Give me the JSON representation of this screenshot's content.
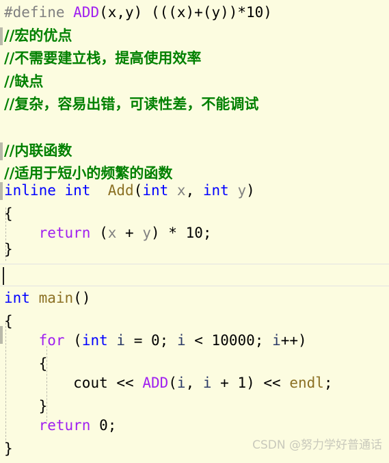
{
  "editor": {
    "background_color": "#fcfce0",
    "current_line_index": 11,
    "language": "C++",
    "watermark": "CSDN @努力学好普通话",
    "lines": [
      {
        "n": 0,
        "text": "#define ADD(x,y) (((x)+(y))*10)"
      },
      {
        "n": 1,
        "text": "//宏的优点"
      },
      {
        "n": 2,
        "text": "//不需要建立栈，提高使用效率"
      },
      {
        "n": 3,
        "text": "//缺点"
      },
      {
        "n": 4,
        "text": "//复杂，容易出错，可读性差，不能调试"
      },
      {
        "n": 5,
        "text": ""
      },
      {
        "n": 6,
        "text": "//内联函数"
      },
      {
        "n": 7,
        "text": "//适用于短小的频繁的函数"
      },
      {
        "n": 8,
        "text": "inline int  Add(int x, int y)"
      },
      {
        "n": 9,
        "text": "{"
      },
      {
        "n": 10,
        "text": "    return (x + y) * 10;"
      },
      {
        "n": 11,
        "text": "}"
      },
      {
        "n": 12,
        "text": ""
      },
      {
        "n": 13,
        "text": "int main()"
      },
      {
        "n": 14,
        "text": "{"
      },
      {
        "n": 15,
        "text": "    for (int i = 0; i < 10000; i++)"
      },
      {
        "n": 16,
        "text": "    {"
      },
      {
        "n": 17,
        "text": "        cout << ADD(i, i + 1) << endl;"
      },
      {
        "n": 18,
        "text": "    }"
      },
      {
        "n": 19,
        "text": "    return 0;"
      },
      {
        "n": 20,
        "text": "}"
      }
    ],
    "tokens": {
      "l0_a": "#define ",
      "l0_b": "ADD",
      "l0_c": "(x,y) (((x)+(y))*10)",
      "l1": "//宏的优点",
      "l2": "//不需要建立栈，提高使用效率",
      "l3": "//缺点",
      "l4": "//复杂，容易出错，可读性差，不能调试",
      "l6": "//内联函数",
      "l7": "//适用于短小的频繁的函数",
      "l8_a": "inline int",
      "l8_b": "  ",
      "l8_c": "Add",
      "l8_d": "(",
      "l8_e": "int",
      "l8_f": " x",
      "l8_g": ", ",
      "l8_h": "int",
      "l8_i": " y",
      "l8_j": ")",
      "l9": "{",
      "l10_a": "    ",
      "l10_b": "return",
      "l10_c": " (",
      "l10_d": "x",
      "l10_e": " + ",
      "l10_f": "y",
      "l10_g": ") * ",
      "l10_h": "10",
      "l10_i": ";",
      "l11": "}",
      "l13_a": "int",
      "l13_b": " ",
      "l13_c": "main",
      "l13_d": "()",
      "l14": "{",
      "l15_a": "    ",
      "l15_b": "for",
      "l15_c": " (",
      "l15_d": "int",
      "l15_e": " ",
      "l15_f": "i",
      "l15_g": " = ",
      "l15_h": "0",
      "l15_i": "; ",
      "l15_j": "i",
      "l15_k": " < ",
      "l15_l": "10000",
      "l15_m": "; ",
      "l15_n": "i",
      "l15_o": "++)",
      "l16": "    {",
      "l17_a": "        ",
      "l17_b": "cout",
      "l17_c": " << ",
      "l17_d": "ADD",
      "l17_e": "(",
      "l17_f": "i",
      "l17_g": ", ",
      "l17_h": "i",
      "l17_i": " + ",
      "l17_j": "1",
      "l17_k": ") << ",
      "l17_l": "endl",
      "l17_m": ";",
      "l18": "    }",
      "l19_a": "    ",
      "l19_b": "return",
      "l19_c": " ",
      "l19_d": "0",
      "l19_e": ";",
      "l20": "}"
    },
    "colors": {
      "background": "#fcfce0",
      "comment": "#008000",
      "keyword": "#0000ff",
      "macro": "#a020f0",
      "function": "#8b7023",
      "variable": "#808080",
      "preprocessor": "#808080",
      "plain": "#000000",
      "guide": "#bdbdb0",
      "watermark": "#c9c9bc"
    }
  }
}
